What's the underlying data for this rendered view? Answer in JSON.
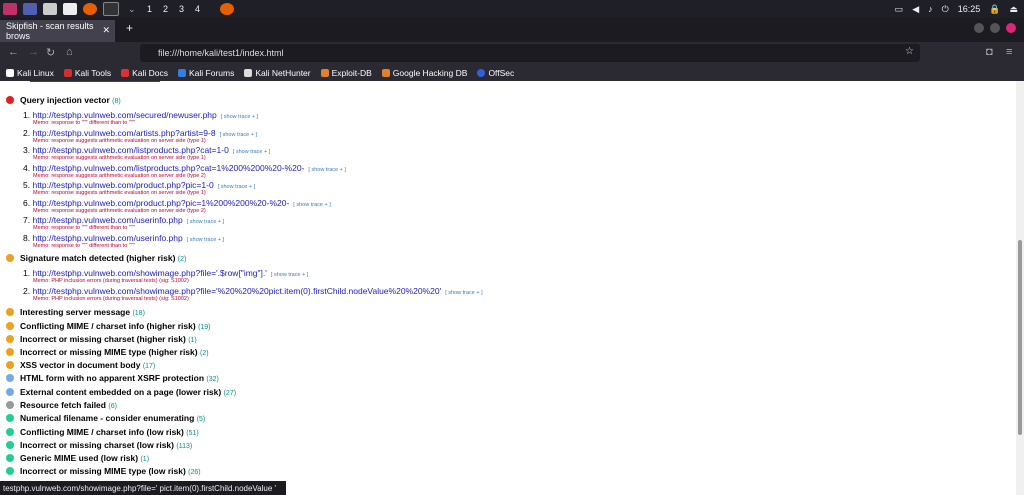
{
  "taskbar": {
    "workspaces": [
      "1",
      "2",
      "3",
      "4"
    ],
    "clock": "16:25"
  },
  "browser": {
    "tab_title": "Skipfish - scan results brows",
    "url": "file:///home/kali/test1/index.html",
    "bookmarks": [
      "Kali Linux",
      "Kali Tools",
      "Kali Docs",
      "Kali Forums",
      "Kali NetHunter",
      "Exploit-DB",
      "Google Hacking DB",
      "OffSec"
    ]
  },
  "page": {
    "trace_label": "[ show trace + ]",
    "categories": [
      {
        "title": "Query injection vector",
        "count": "(8)",
        "severity": "red"
      },
      {
        "title": "Signature match detected (higher risk)",
        "count": "(2)",
        "severity": "orange"
      },
      {
        "title": "Interesting server message",
        "count": "(18)",
        "severity": "orange"
      },
      {
        "title": "Conflicting MIME / charset info (higher risk)",
        "count": "(19)",
        "severity": "orange"
      },
      {
        "title": "Incorrect or missing charset (higher risk)",
        "count": "(1)",
        "severity": "orange"
      },
      {
        "title": "Incorrect or missing MIME type (higher risk)",
        "count": "(2)",
        "severity": "orange"
      },
      {
        "title": "XSS vector in document body",
        "count": "(17)",
        "severity": "orange"
      },
      {
        "title": "HTML form with no apparent XSRF protection",
        "count": "(32)",
        "severity": "blue"
      },
      {
        "title": "External content embedded on a page (lower risk)",
        "count": "(27)",
        "severity": "blue"
      },
      {
        "title": "Resource fetch failed",
        "count": "(6)",
        "severity": "gray"
      },
      {
        "title": "Numerical filename - consider enumerating",
        "count": "(5)",
        "severity": "green"
      },
      {
        "title": "Conflicting MIME / charset info (low risk)",
        "count": "(51)",
        "severity": "green"
      },
      {
        "title": "Incorrect or missing charset (low risk)",
        "count": "(113)",
        "severity": "green"
      },
      {
        "title": "Generic MIME used (low risk)",
        "count": "(1)",
        "severity": "green"
      },
      {
        "title": "Incorrect or missing MIME type (low risk)",
        "count": "(26)",
        "severity": "green"
      }
    ],
    "query_items": [
      {
        "num": "1.",
        "url": "http://testphp.vulnweb.com/secured/newuser.php",
        "memo": "Memo: response to '\"\"' different than to '\"\"'"
      },
      {
        "num": "2.",
        "url": "http://testphp.vulnweb.com/artists.php?artist=9-8",
        "memo": "Memo: response suggests arithmetic evaluation on server side (type 1)"
      },
      {
        "num": "3.",
        "url": "http://testphp.vulnweb.com/listproducts.php?cat=1-0",
        "memo": "Memo: response suggests arithmetic evaluation on server side (type 1)"
      },
      {
        "num": "4.",
        "url": "http://testphp.vulnweb.com/listproducts.php?cat=1%200%200%20-%20-",
        "memo": "Memo: response suggests arithmetic evaluation on server side (type 2)"
      },
      {
        "num": "5.",
        "url": "http://testphp.vulnweb.com/product.php?pic=1-0",
        "memo": "Memo: response suggests arithmetic evaluation on server side (type 1)"
      },
      {
        "num": "6.",
        "url": "http://testphp.vulnweb.com/product.php?pic=1%200%200%20-%20-",
        "memo": "Memo: response suggests arithmetic evaluation on server side (type 2)"
      },
      {
        "num": "7.",
        "url": "http://testphp.vulnweb.com/userinfo.php",
        "memo": "Memo: response to '\"\"' different than to '\"\"'"
      },
      {
        "num": "8.",
        "url": "http://testphp.vulnweb.com/userinfo.php",
        "memo": "Memo: response to '\"\"' different than to '\"\"'"
      }
    ],
    "signature_items": [
      {
        "num": "1.",
        "url": "http://testphp.vulnweb.com/showimage.php?file='.$row[\"img\"].'",
        "memo": "Memo: PHP inclusion errors (during traversal tests) (sig: S1002)"
      },
      {
        "num": "2.",
        "url": "http://testphp.vulnweb.com/showimage.php?file='%20%20%20pict.item(0).firstChild.nodeValue%20%20%20'",
        "memo": "Memo: PHP inclusion errors (during traversal tests) (sig: S1002)"
      }
    ]
  },
  "status_bar": "testphp.vulnweb.com/showimage.php?file='   pict.item(0).firstChild.nodeValue   '"
}
